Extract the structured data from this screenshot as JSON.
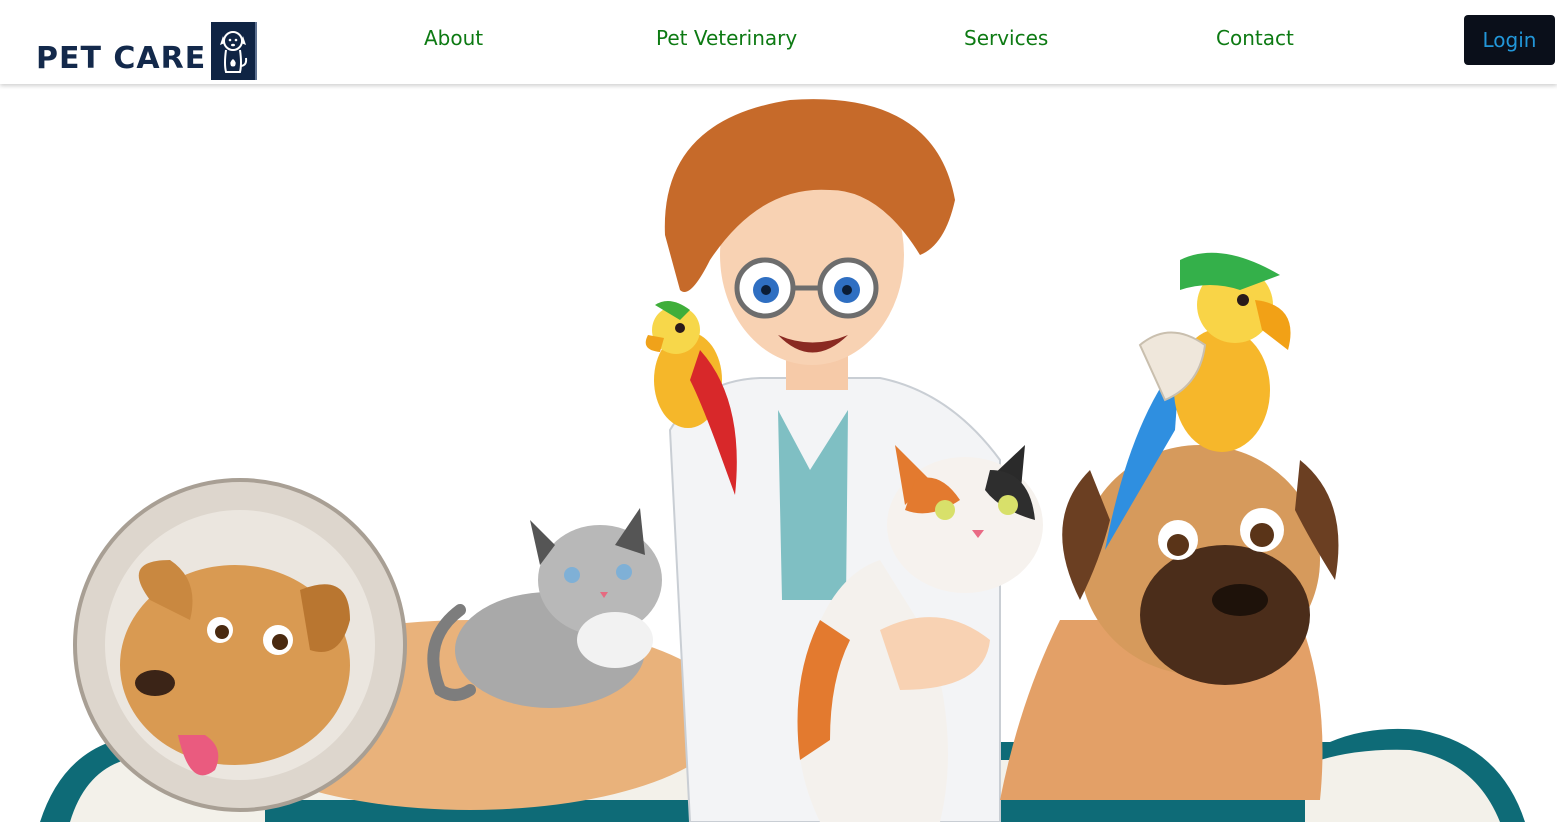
{
  "brand": {
    "name": "PET CARE",
    "logo_icon": "dog-cat-icon"
  },
  "nav": {
    "items": [
      {
        "label": "About"
      },
      {
        "label": "Pet Veterinary"
      },
      {
        "label": "Services"
      },
      {
        "label": "Contact"
      }
    ],
    "login_label": "Login"
  },
  "colors": {
    "brand_navy": "#13294b",
    "nav_green": "#0d7a13",
    "login_bg": "#0a0f1a",
    "login_text": "#2296d8",
    "bone_teal": "#0e6b77"
  },
  "hero": {
    "illustration": "veterinarian-with-pets"
  }
}
